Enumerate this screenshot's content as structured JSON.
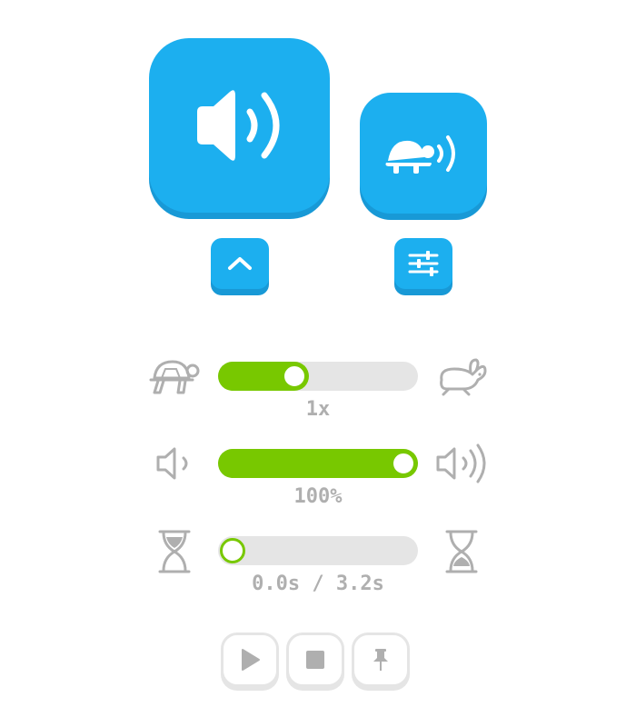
{
  "controls": {
    "speak_button_icon": "speaker-icon",
    "slow_speak_button_icon": "turtle-speaker-icon",
    "expand_button_icon": "chevron-up-icon",
    "settings_button_icon": "sliders-icon"
  },
  "speed": {
    "label": "1x",
    "level": 0.36,
    "min_icon": "turtle-icon",
    "max_icon": "rabbit-icon"
  },
  "volume": {
    "label": "100%",
    "level": 1.0,
    "min_icon": "volume-low-icon",
    "max_icon": "volume-high-icon"
  },
  "progress": {
    "label": "0.0s / 3.2s",
    "level": 0.0,
    "min_icon": "hourglass-full-top-icon",
    "max_icon": "hourglass-full-bottom-icon"
  },
  "playback": {
    "play_icon": "play-icon",
    "stop_icon": "stop-icon",
    "pin_icon": "pin-icon"
  },
  "colors": {
    "primary_blue": "#1cafef",
    "blue_shadow": "#1899d6",
    "accent_green": "#78c800",
    "track_gray": "#e5e5e5",
    "icon_gray": "#afafaf"
  }
}
